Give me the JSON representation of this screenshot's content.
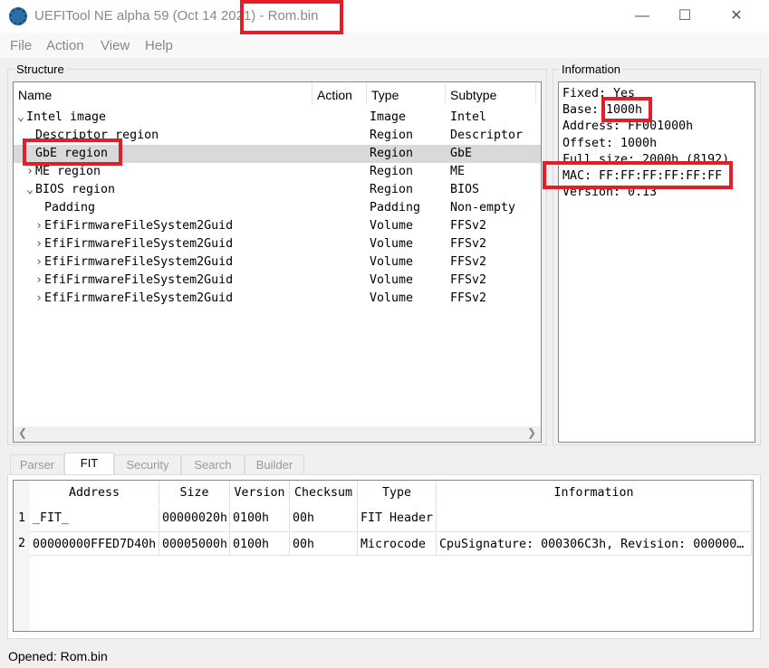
{
  "window": {
    "title": "UEFITool NE alpha 59 (Oct 14 2021) - Rom.bin",
    "minimize": "—",
    "maximize": "☐",
    "close": "✕"
  },
  "menu": [
    "File",
    "Action",
    "View",
    "Help"
  ],
  "structure": {
    "label": "Structure",
    "columns": [
      "Name",
      "Action",
      "Type",
      "Subtype"
    ],
    "rows": [
      {
        "indent": 0,
        "expander": "⌄",
        "name": "Intel image",
        "action": "",
        "type": "Image",
        "subtype": "Intel"
      },
      {
        "indent": 1,
        "expander": "",
        "name": "Descriptor region",
        "action": "",
        "type": "Region",
        "subtype": "Descriptor"
      },
      {
        "indent": 1,
        "expander": "",
        "name": "GbE region",
        "action": "",
        "type": "Region",
        "subtype": "GbE",
        "selected": true
      },
      {
        "indent": 1,
        "expander": "›",
        "name": "ME region",
        "action": "",
        "type": "Region",
        "subtype": "ME"
      },
      {
        "indent": 1,
        "expander": "⌄",
        "name": "BIOS region",
        "action": "",
        "type": "Region",
        "subtype": "BIOS"
      },
      {
        "indent": 2,
        "expander": "",
        "name": "Padding",
        "action": "",
        "type": "Padding",
        "subtype": "Non-empty"
      },
      {
        "indent": 2,
        "expander": "›",
        "name": "EfiFirmwareFileSystem2Guid",
        "action": "",
        "type": "Volume",
        "subtype": "FFSv2"
      },
      {
        "indent": 2,
        "expander": "›",
        "name": "EfiFirmwareFileSystem2Guid",
        "action": "",
        "type": "Volume",
        "subtype": "FFSv2"
      },
      {
        "indent": 2,
        "expander": "›",
        "name": "EfiFirmwareFileSystem2Guid",
        "action": "",
        "type": "Volume",
        "subtype": "FFSv2"
      },
      {
        "indent": 2,
        "expander": "›",
        "name": "EfiFirmwareFileSystem2Guid",
        "action": "",
        "type": "Volume",
        "subtype": "FFSv2"
      },
      {
        "indent": 2,
        "expander": "›",
        "name": "EfiFirmwareFileSystem2Guid",
        "action": "",
        "type": "Volume",
        "subtype": "FFSv2"
      }
    ]
  },
  "information": {
    "label": "Information",
    "lines": [
      "Fixed: Yes",
      "Base: 1000h",
      "Address: FF001000h",
      "Offset: 1000h",
      "Full size: 2000h (8192)",
      "MAC: FF:FF:FF:FF:FF:FF",
      "Version: 0.13"
    ]
  },
  "tabs": [
    {
      "label": "Parser"
    },
    {
      "label": "FIT",
      "active": true
    },
    {
      "label": "Security"
    },
    {
      "label": "Search"
    },
    {
      "label": "Builder"
    }
  ],
  "fit": {
    "columns": [
      "Address",
      "Size",
      "Version",
      "Checksum",
      "Type",
      "Information"
    ],
    "rows": [
      {
        "num": "1",
        "cells": [
          "_FIT_",
          "00000020h",
          "0100h",
          "00h",
          "FIT Header",
          ""
        ]
      },
      {
        "num": "2",
        "cells": [
          "00000000FFED7D40h",
          "00005000h",
          "0100h",
          "00h",
          "Microcode",
          "CpuSignature: 000306C3h, Revision: 000000…"
        ]
      }
    ]
  },
  "status": "Opened: Rom.bin"
}
